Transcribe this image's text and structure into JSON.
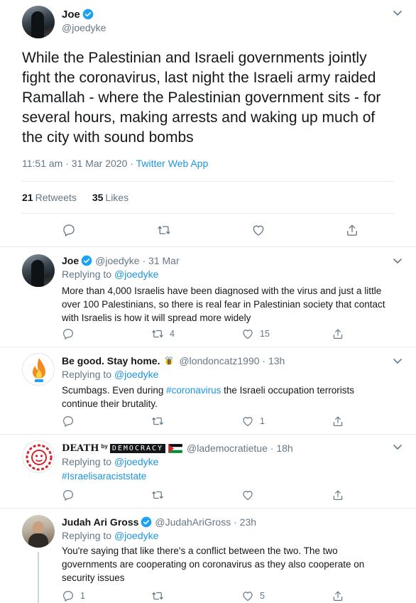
{
  "main_tweet": {
    "name": "Joe",
    "handle": "@joedyke",
    "text": "While the Palestinian and Israeli governments jointly fight the coronavirus, last night the Israeli army raided Ramallah - where the Palestinian government sits - for several hours, making arrests and waking up much of the city with sound bombs",
    "time": "11:51 am · 31 Mar 2020 · ",
    "source": "Twitter Web App",
    "retweets_count": "21",
    "retweets_label": "Retweets",
    "likes_count": "35",
    "likes_label": "Likes"
  },
  "replies": [
    {
      "name": "Joe",
      "handle": "@joedyke · 31 Mar",
      "replying_label": "Replying to",
      "replying_to": "@joedyke",
      "text": "More than 4,000 Israelis have been diagnosed with the virus and just a little over 100 Palestinians, so there is real fear in Palestinian society that contact with Israelis is how it will spread more widely",
      "replies": "",
      "retweets": "4",
      "likes": "15"
    },
    {
      "name": "Be good. Stay home.",
      "handle": "@londoncatz1990 · 13h",
      "replying_label": "Replying to",
      "replying_to": "@joedyke",
      "text_before": "Scumbags. Even during ",
      "hashtag": "#coronavirus",
      "text_after": " the Israeli occupation terrorists continue their brutality.",
      "replies": "",
      "retweets": "",
      "likes": "1"
    },
    {
      "name": "DEATH",
      "name_by": "by",
      "name_tag": "DEMOCRACY",
      "handle": "@lademocratietue · 18h",
      "replying_label": "Replying to",
      "replying_to": "@joedyke",
      "hashtag": "#Israelisaraciststate",
      "replies": "",
      "retweets": "",
      "likes": ""
    },
    {
      "name": "Judah Ari Gross",
      "handle": "@JudahAriGross · 23h",
      "replying_label": "Replying to",
      "replying_to": "@joedyke",
      "text": "You're saying that like there's a conflict between the two. The two governments are cooperating on coronavirus as they also cooperate on security issues",
      "replies": "1",
      "retweets": "",
      "likes": "5"
    }
  ],
  "colors": {
    "accent": "#1b95e0",
    "muted": "#657786",
    "text": "#14171a",
    "divider": "#e6ecf0"
  }
}
